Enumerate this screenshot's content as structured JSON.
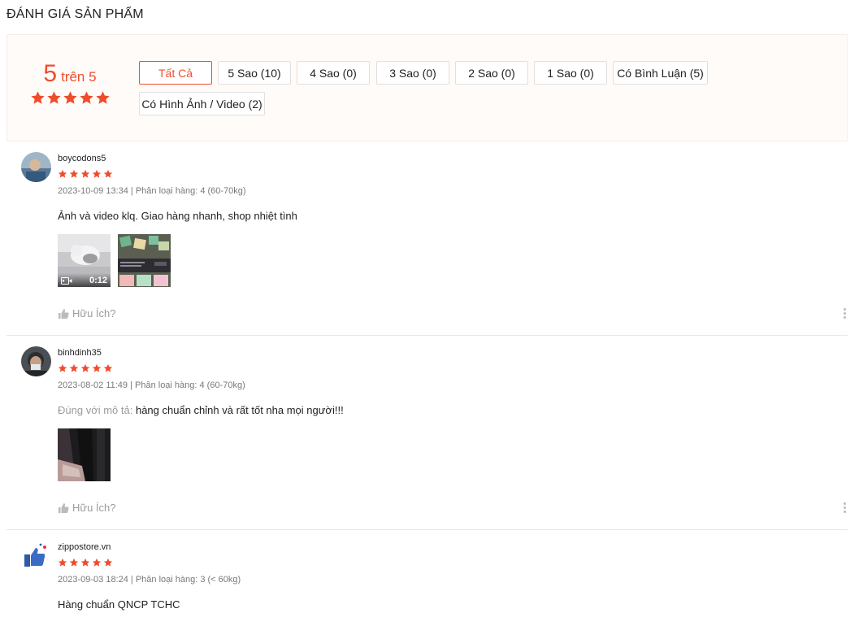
{
  "section_title": "ĐÁNH GIÁ SẢN PHẨM",
  "summary": {
    "score": "5",
    "suffix": "trên 5",
    "stars": 5
  },
  "filters": [
    {
      "label": "Tất Cả",
      "active": true
    },
    {
      "label": "5 Sao (10)"
    },
    {
      "label": "4 Sao (0)"
    },
    {
      "label": "3 Sao (0)"
    },
    {
      "label": "2 Sao (0)"
    },
    {
      "label": "1 Sao (0)"
    },
    {
      "label": "Có Bình Luận (5)"
    },
    {
      "label": "Có Hình Ảnh / Video (2)"
    }
  ],
  "reviews": [
    {
      "username": "boycodons5",
      "rating": 5,
      "meta": "2023-10-09 13:34 | Phân loại hàng: 4 (60-70kg)",
      "content": "Ảnh và video klq. Giao hàng nhanh, shop nhiệt tình",
      "video_duration": "0:12",
      "helpful": "Hữu Ích?"
    },
    {
      "username": "binhdinh35",
      "rating": 5,
      "meta": "2023-08-02 11:49 | Phân loại hàng: 4 (60-70kg)",
      "content_label": "Đúng với mô tả:",
      "content": "hàng chuẩn chỉnh và rất tốt nha mọi người!!!",
      "helpful": "Hữu Ích?"
    },
    {
      "username": "zippostore.vn",
      "rating": 5,
      "meta": "2023-09-03 18:24 | Phân loại hàng: 3 (< 60kg)",
      "content": "Hàng chuẩn QNCP TCHC"
    }
  ],
  "colors": {
    "accent": "#ee4d2d",
    "overview_bg": "#fffbf8"
  },
  "icons": [
    "star-icon",
    "thumbs-up-icon",
    "video-camera-icon",
    "more-options-icon"
  ]
}
